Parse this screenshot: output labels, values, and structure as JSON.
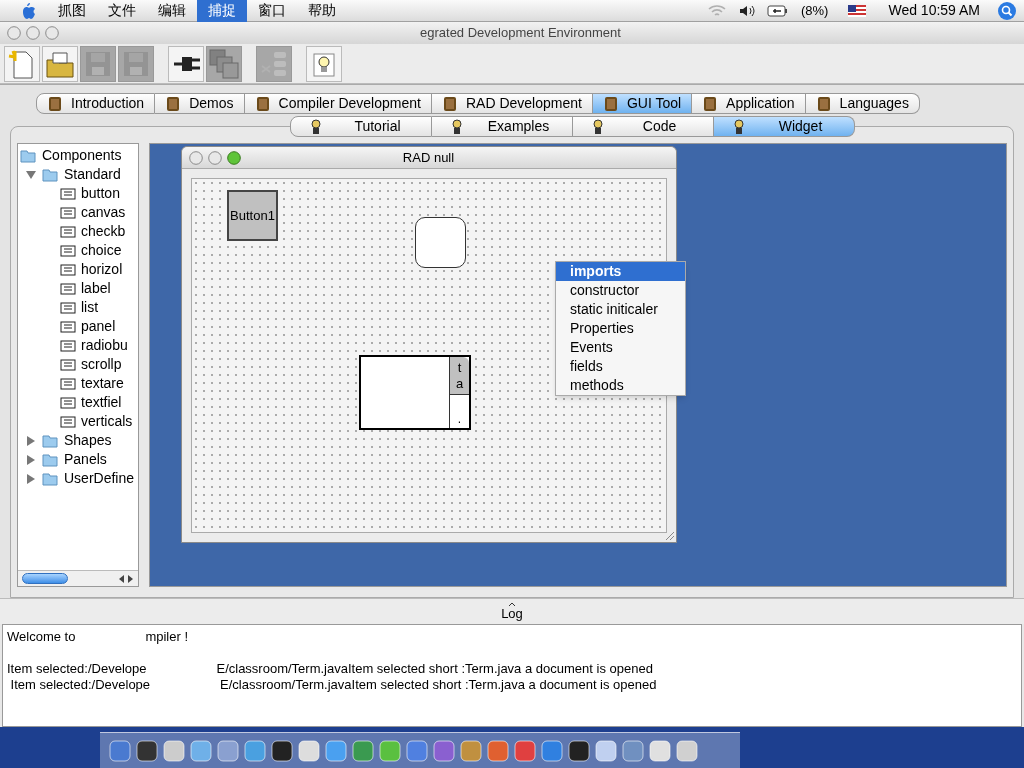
{
  "menu_bar": {
    "menus": [
      {
        "label": "抓图",
        "selected": false
      },
      {
        "label": "文件",
        "selected": false
      },
      {
        "label": "编辑",
        "selected": false
      },
      {
        "label": "捕捉",
        "selected": true
      },
      {
        "label": "窗口",
        "selected": false
      },
      {
        "label": "帮助",
        "selected": false
      }
    ],
    "battery": "(8%)",
    "clock": "Wed 10:59 AM"
  },
  "window": {
    "title": "egrated Development Environment"
  },
  "toolbar": [
    {
      "kind": "new",
      "disabled": false
    },
    {
      "kind": "open",
      "disabled": false
    },
    {
      "kind": "save",
      "disabled": true
    },
    {
      "kind": "save",
      "disabled": true
    },
    {
      "kind": "plug",
      "disabled": false
    },
    {
      "kind": "stack",
      "disabled": true
    },
    {
      "kind": "cut",
      "disabled": true
    },
    {
      "kind": "bulb",
      "disabled": false
    }
  ],
  "tabs": [
    {
      "label": "Introduction",
      "selected": false
    },
    {
      "label": "Demos",
      "selected": false
    },
    {
      "label": "Compiler Development",
      "selected": false
    },
    {
      "label": "RAD Development",
      "selected": false
    },
    {
      "label": "GUI Tool",
      "selected": true
    },
    {
      "label": "Application",
      "selected": false
    },
    {
      "label": "Languages",
      "selected": false
    }
  ],
  "subtabs": [
    {
      "label": "Tutorial",
      "selected": false
    },
    {
      "label": "Examples",
      "selected": false
    },
    {
      "label": "Code",
      "selected": false
    },
    {
      "label": "Widget",
      "selected": true
    }
  ],
  "tree": {
    "label": "Components",
    "children": [
      {
        "label": "Standard",
        "expanded": true,
        "children": [
          {
            "label": "button"
          },
          {
            "label": "canvas"
          },
          {
            "label": "checkb"
          },
          {
            "label": "choice"
          },
          {
            "label": "horizol"
          },
          {
            "label": "label"
          },
          {
            "label": "list"
          },
          {
            "label": "panel"
          },
          {
            "label": "radiobu"
          },
          {
            "label": "scrollp"
          },
          {
            "label": "textare"
          },
          {
            "label": "textfiel"
          },
          {
            "label": "verticals"
          }
        ]
      },
      {
        "label": "Shapes",
        "expanded": false
      },
      {
        "label": "Panels",
        "expanded": false
      },
      {
        "label": "UserDefine",
        "expanded": false
      }
    ]
  },
  "designer": {
    "title": "RAD null",
    "items": [
      {
        "kind": "button",
        "label": "Button1"
      },
      {
        "kind": "rounded"
      },
      {
        "kind": "textarea",
        "tab": [
          "t",
          "a"
        ],
        "corner": "."
      }
    ]
  },
  "context_menu": [
    {
      "label": "imports",
      "selected": true
    },
    {
      "label": "constructor",
      "selected": false
    },
    {
      "label": "static initicaler",
      "selected": false
    },
    {
      "label": "Properties",
      "selected": false
    },
    {
      "label": "Events",
      "selected": false
    },
    {
      "label": "fields",
      "selected": false
    },
    {
      "label": "methods",
      "selected": false
    }
  ],
  "log": {
    "label": "Log",
    "lines": [
      {
        "segments": [
          "Welcome to",
          "mpiler !"
        ]
      },
      {
        "segments": [
          "Item selected:/Develope",
          "E/classroom/Term.javaItem selected short :Term.java a document is opened"
        ]
      },
      {
        "segments": [
          " Item selected:/Develope",
          "E/classroom/Term.javaItem selected short :Term.java a document is opened"
        ]
      }
    ]
  }
}
